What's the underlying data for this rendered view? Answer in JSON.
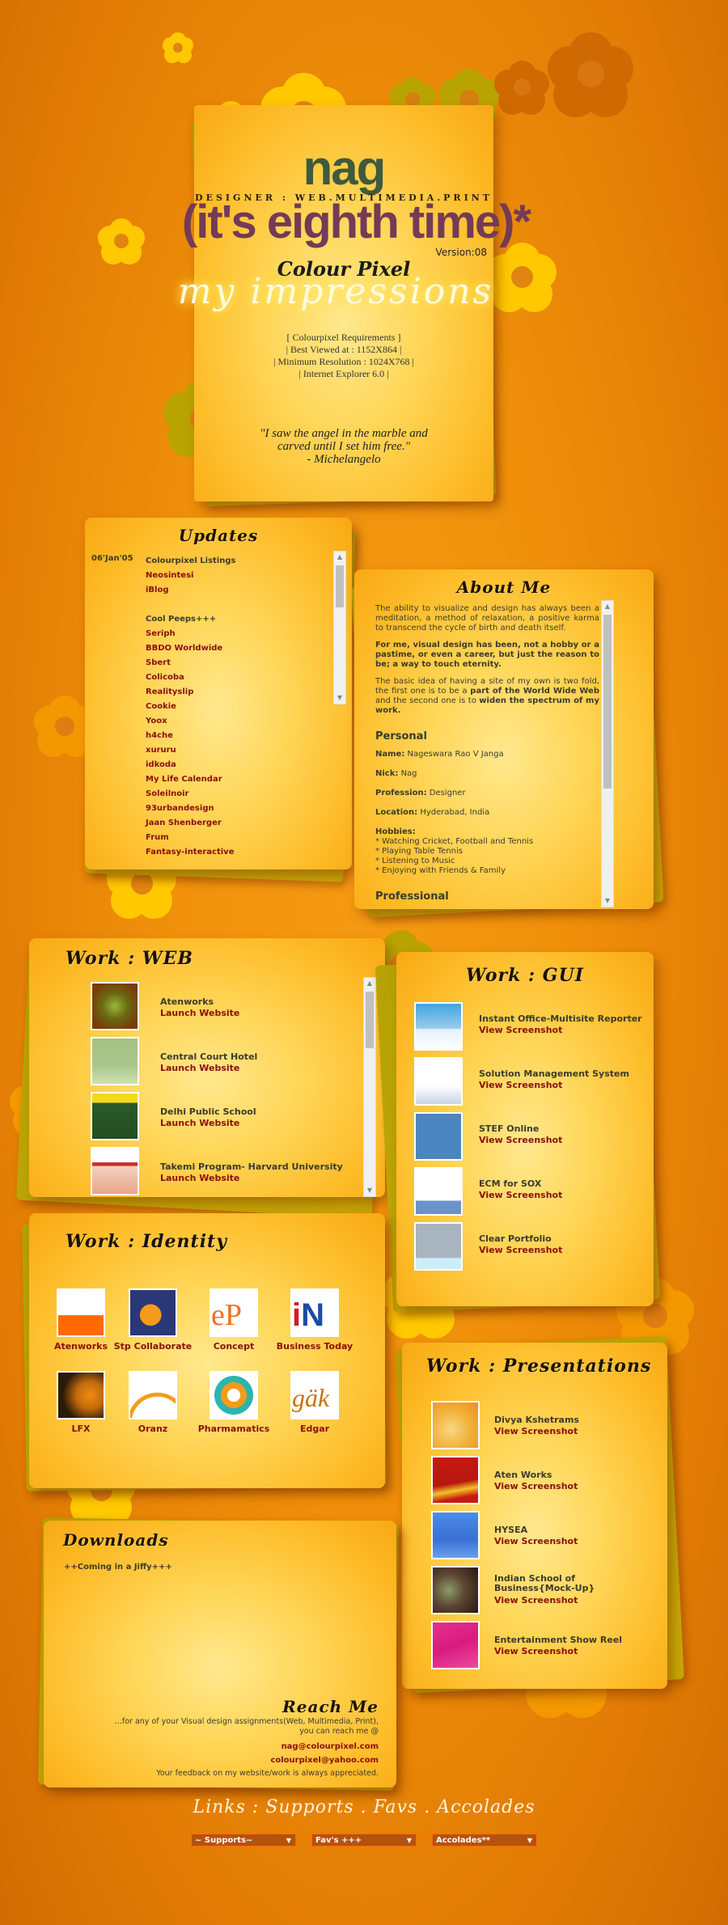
{
  "header": {
    "name": "nag",
    "tagline": "DESIGNER : WEB.MULTIMEDIA.PRINT",
    "headline": "(it's eighth time)*",
    "version": "Version:08",
    "brand": "Colour Pixel",
    "script_title": "my impressions",
    "requirements": [
      "[ Colourpixel Requirements ]",
      "| Best Viewed at : 1152X864 |",
      "| Minimum Resolution : 1024X768 |",
      "| Internet Explorer 6.0 |"
    ],
    "quote": [
      "\"I saw the angel in the marble and",
      "carved until I set him free.\"",
      "- Michelangelo"
    ]
  },
  "updates": {
    "title": "Updates",
    "date": "06'Jan'05",
    "groups": [
      {
        "heading": "Colourpixel Listings",
        "items": [
          "Neosintesi",
          "iBlog"
        ]
      },
      {
        "heading": "Cool Peeps+++",
        "items": [
          "Seriph",
          "BBDO Worldwide",
          "Sbert",
          "Colicoba",
          "Realityslip",
          "Cookie",
          "Yoox",
          "h4che",
          "xururu",
          "idkoda",
          "My Life Calendar",
          "Soleilnoir",
          "93urbandesign",
          "Jaan Shenberger",
          "Frum",
          "Fantasy-interactive"
        ]
      }
    ]
  },
  "about": {
    "title": "About Me",
    "p1": "The ability to visualize and design has always been a meditation, a method of relaxation, a positive karma to transcend the cycle of birth and death itself.",
    "p2": "For me, visual design has been, not a hobby or a pastime, or even a career, but just the reason to be; a way to touch eternity.",
    "p3_a": "The basic idea of having a site of my own is two fold, the first one is to be a ",
    "p3_b": "part of the World Wide Web",
    "p3_c": " and the second one is to ",
    "p3_d": "widen the spectrum of my work.",
    "personal_heading": "Personal",
    "fields": [
      {
        "label": "Name:",
        "value": "Nageswara Rao V Janga"
      },
      {
        "label": "Nick:",
        "value": "Nag"
      },
      {
        "label": "Profession:",
        "value": "Designer"
      },
      {
        "label": "Location:",
        "value": "Hyderabad, India"
      }
    ],
    "hobbies_label": "Hobbies:",
    "hobbies": [
      "* Watching Cricket, Football and Tennis",
      "* Playing Table Tennis",
      "* Listening to Music",
      "* Enjoying with Friends & Family"
    ],
    "professional_heading": "Professional"
  },
  "work_web": {
    "title": "Work : WEB",
    "items": [
      {
        "name": "Atenworks",
        "link": "Launch Website"
      },
      {
        "name": "Central Court Hotel",
        "link": "Launch Website"
      },
      {
        "name": "Delhi Public School",
        "link": "Launch Website"
      },
      {
        "name": "Takemi Program- Harvard University",
        "link": "Launch Website"
      }
    ]
  },
  "work_gui": {
    "title": "Work : GUI",
    "items": [
      {
        "name": "Instant Office-Multisite Reporter",
        "link": "View Screenshot"
      },
      {
        "name": "Solution Management System",
        "link": "View Screenshot"
      },
      {
        "name": "STEF Online",
        "link": "View Screenshot"
      },
      {
        "name": "ECM for SOX",
        "link": "View Screenshot"
      },
      {
        "name": "Clear Portfolio",
        "link": "View Screenshot"
      }
    ]
  },
  "work_identity": {
    "title": "Work : Identity",
    "items": [
      "Atenworks",
      "Stp Collaborate",
      "Concept",
      "Business Today",
      "LFX",
      "Oranz",
      "Pharmamatics",
      "Edgar"
    ]
  },
  "work_presentations": {
    "title": "Work : Presentations",
    "items": [
      {
        "name": "Divya Kshetrams",
        "link": "View Screenshot"
      },
      {
        "name": "Aten Works",
        "link": "View Screenshot"
      },
      {
        "name": "HYSEA",
        "link": "View Screenshot"
      },
      {
        "name": "Indian School of Business{Mock-Up}",
        "link": "View Screenshot"
      },
      {
        "name": "Entertainment Show Reel",
        "link": "View Screenshot"
      }
    ]
  },
  "downloads": {
    "title": "Downloads",
    "text": "++Coming in a Jiffy+++"
  },
  "reach": {
    "title": "Reach Me",
    "line1": "...for any of your Visual design assignments(Web, Multimedia, Print),",
    "line2": "you can reach me @",
    "email1": "nag@colourpixel.com",
    "email2": "colourpixel@yahoo.com",
    "feedback": "Your feedback on my website/work is always appreciated."
  },
  "links": {
    "title": "Links : Supports . Favs . Accolades",
    "selects": [
      "~ Supports~",
      "Fav's +++",
      "Accolades**"
    ]
  }
}
